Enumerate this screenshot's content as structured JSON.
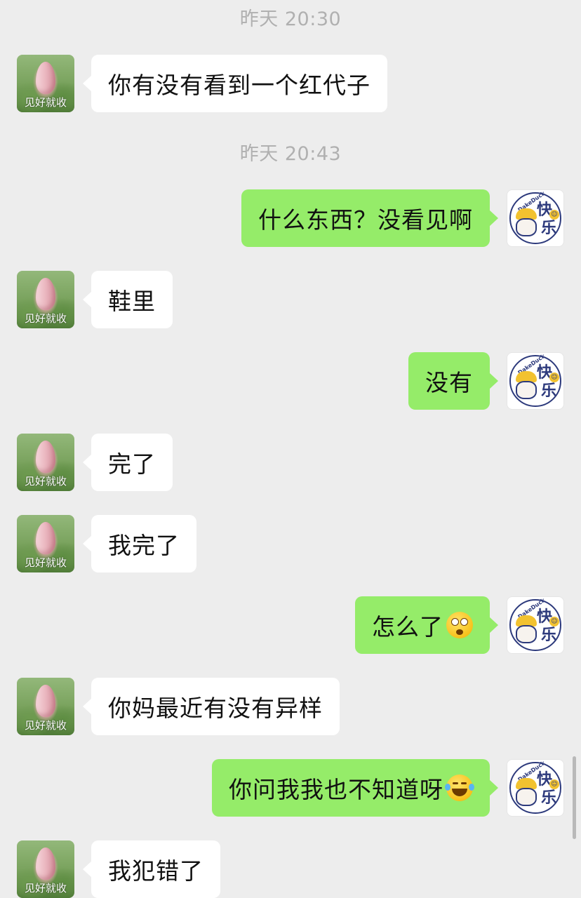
{
  "chat": {
    "timestamps": [
      "昨天 20:30",
      "昨天 20:43"
    ],
    "contact_avatar_caption": "见好就收",
    "self_avatar": {
      "text_top": "快",
      "text_bottom": "乐",
      "tiny_text": "DakeDuck",
      "smile_glyph": "☺"
    },
    "messages": [
      {
        "side": "left",
        "text": "你有没有看到一个红代子"
      },
      {
        "side": "right",
        "text": "什么东西？没看见啊"
      },
      {
        "side": "left",
        "text": "鞋里"
      },
      {
        "side": "right",
        "text": "没有"
      },
      {
        "side": "left",
        "text": "完了"
      },
      {
        "side": "left",
        "text": "我完了"
      },
      {
        "side": "right",
        "text": "怎么了",
        "emoji": "astonished-face"
      },
      {
        "side": "left",
        "text": "你妈最近有没有异样"
      },
      {
        "side": "right",
        "text": "你问我我也不知道呀",
        "emoji": "tears-of-joy-face"
      },
      {
        "side": "left",
        "text": "我犯错了"
      }
    ]
  },
  "colors": {
    "background": "#ededed",
    "incoming_bubble": "#ffffff",
    "outgoing_bubble": "#95ec69",
    "timestamp": "#b0b0b0"
  }
}
